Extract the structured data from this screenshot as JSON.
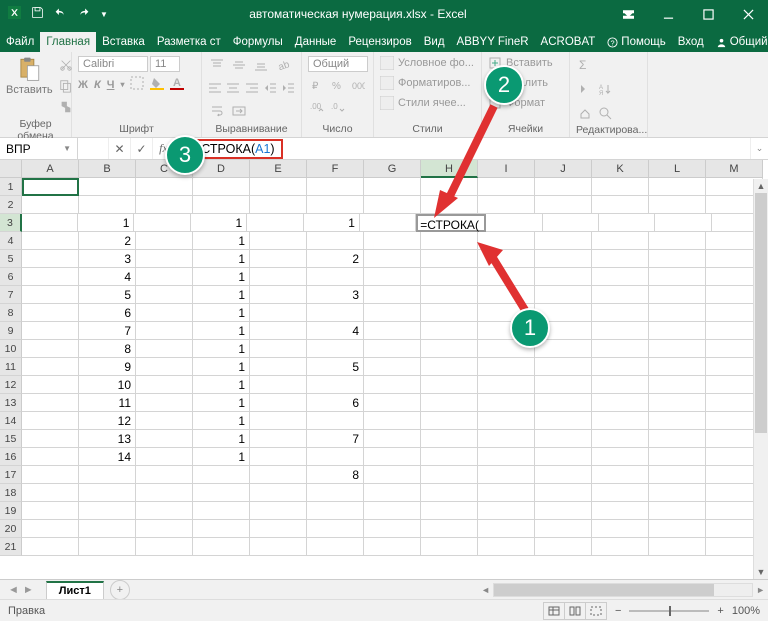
{
  "titlebar": {
    "title": "автоматическая нумерация.xlsx - Excel"
  },
  "tabs": {
    "file": "Файл",
    "home": "Главная",
    "insert": "Вставка",
    "layout": "Разметка ст",
    "formulas": "Формулы",
    "data": "Данные",
    "review": "Рецензиров",
    "view": "Вид",
    "abbyy": "ABBYY FineR",
    "acrobat": "ACROBAT",
    "help": "Помощь",
    "login": "Вход",
    "share": "Общий доступ"
  },
  "ribbon": {
    "paste": "Вставить",
    "clipboard": "Буфер обмена",
    "font_group": "Шрифт",
    "align": "Выравнивание",
    "number": "Число",
    "number_fmt": "Общий",
    "styles": "Стили",
    "cells": "Ячейки",
    "editing": "Редактирова...",
    "font": "Calibri",
    "size": "11",
    "cond": "Условное фо...",
    "fmt_table": "Форматиров...",
    "cell_styles": "Стили ячее...",
    "insert_cell": "Вставить",
    "delete_cell": "Удалить",
    "format_cell": "Формат",
    "bold": "Ж",
    "italic": "К",
    "underline": "Ч"
  },
  "namebox": "ВПР",
  "formula": {
    "prefix": "=СТРОКА(",
    "ref": "A1",
    "suffix": ")"
  },
  "columns": [
    "A",
    "B",
    "C",
    "D",
    "E",
    "F",
    "G",
    "H",
    "I",
    "J",
    "K",
    "L",
    "M"
  ],
  "row_count": 21,
  "cell_formula": "=СТРОКА(",
  "grid_data": {
    "B": {
      "3": "1",
      "4": "2",
      "5": "3",
      "6": "4",
      "7": "5",
      "8": "6",
      "9": "7",
      "10": "8",
      "11": "9",
      "12": "10",
      "13": "11",
      "14": "12",
      "15": "13",
      "16": "14"
    },
    "D": {
      "3": "1",
      "4": "1",
      "5": "1",
      "6": "1",
      "7": "1",
      "8": "1",
      "9": "1",
      "10": "1",
      "11": "1",
      "12": "1",
      "13": "1",
      "14": "1",
      "15": "1",
      "16": "1"
    },
    "F": {
      "3": "1",
      "5": "2",
      "7": "3",
      "9": "4",
      "11": "5",
      "13": "6",
      "15": "7",
      "17": "8"
    }
  },
  "sheet_tab": "Лист1",
  "status": {
    "mode": "Правка",
    "zoom": "100%"
  },
  "badges": {
    "b1": "1",
    "b2": "2",
    "b3": "3"
  }
}
